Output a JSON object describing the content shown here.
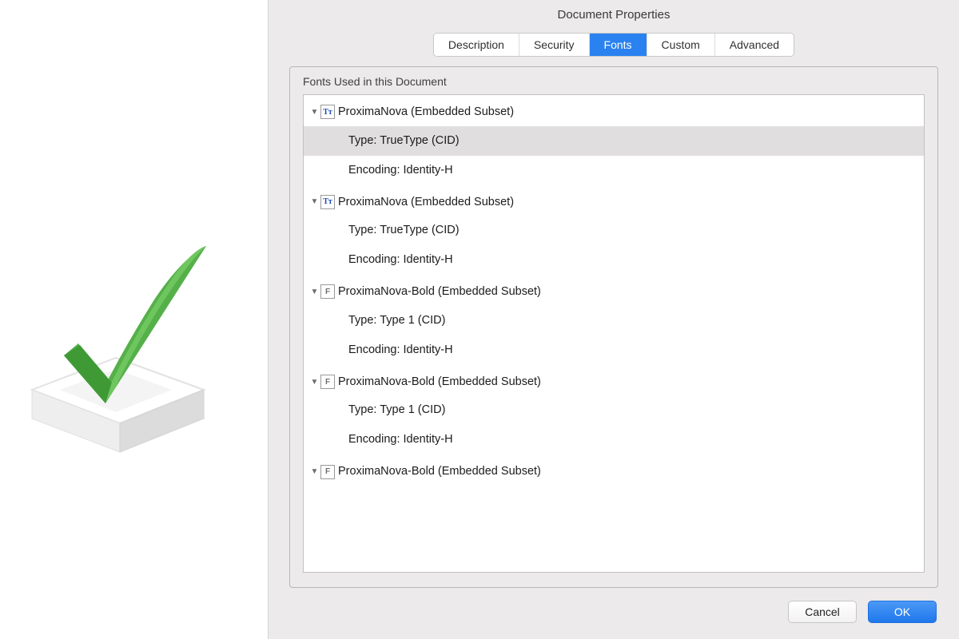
{
  "dialog": {
    "title": "Document Properties",
    "tabs": [
      "Description",
      "Security",
      "Fonts",
      "Custom",
      "Advanced"
    ],
    "active_tab": "Fonts",
    "panel_label": "Fonts Used in this Document",
    "buttons": {
      "cancel": "Cancel",
      "ok": "OK"
    }
  },
  "fonts": [
    {
      "icon": "tt",
      "name": "ProximaNova (Embedded Subset)",
      "type_label": "Type: TrueType (CID)",
      "encoding_label": "Encoding: Identity-H",
      "type_selected": true
    },
    {
      "icon": "tt",
      "name": "ProximaNova (Embedded Subset)",
      "type_label": "Type: TrueType (CID)",
      "encoding_label": "Encoding: Identity-H",
      "type_selected": false
    },
    {
      "icon": "ff",
      "name": "ProximaNova-Bold (Embedded Subset)",
      "type_label": "Type: Type 1 (CID)",
      "encoding_label": "Encoding: Identity-H",
      "type_selected": false
    },
    {
      "icon": "ff",
      "name": "ProximaNova-Bold (Embedded Subset)",
      "type_label": "Type: Type 1 (CID)",
      "encoding_label": "Encoding: Identity-H",
      "type_selected": false
    },
    {
      "icon": "ff",
      "name": "ProximaNova-Bold (Embedded Subset)",
      "type_label": "",
      "encoding_label": "",
      "type_selected": false
    }
  ]
}
